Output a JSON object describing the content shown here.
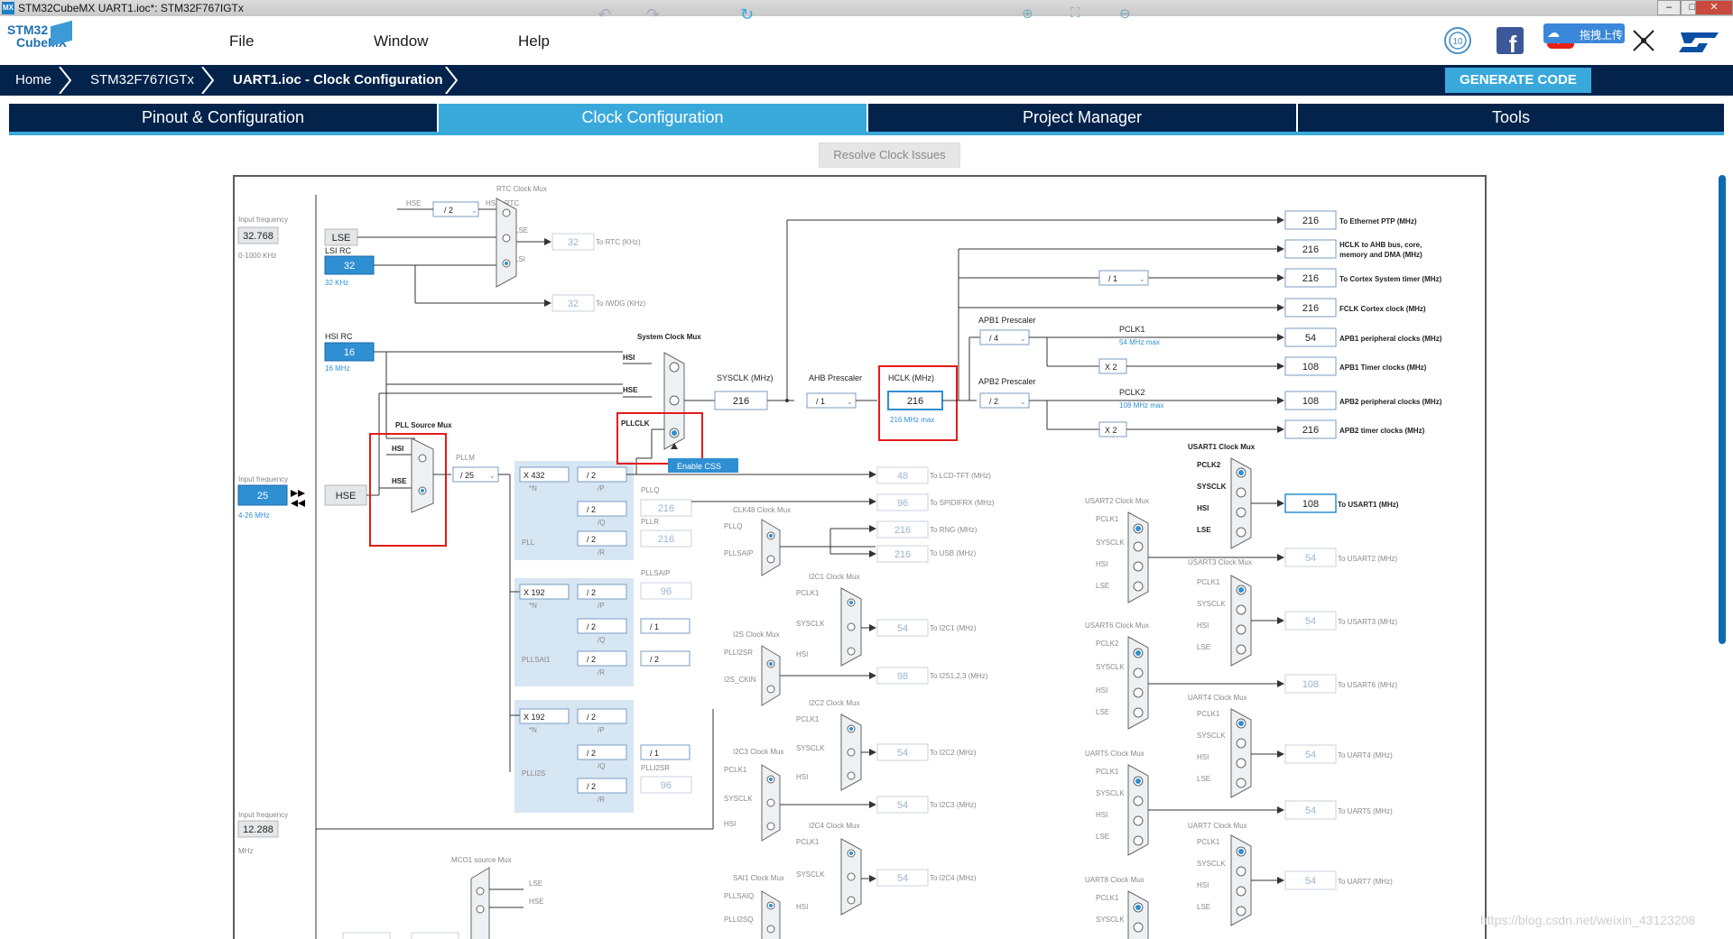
{
  "window": {
    "title": "STM32CubeMX UART1.ioc*: STM32F767IGTx",
    "app_icon": "MX"
  },
  "menubar": {
    "logo_line1": "STM32",
    "logo_line2": "CubeMX",
    "items": [
      "File",
      "Window",
      "Help"
    ],
    "upload_label": "拖拽上传"
  },
  "breadcrumb": [
    "Home",
    "STM32F767IGTx",
    "UART1.ioc - Clock Configuration"
  ],
  "generate_label": "GENERATE CODE",
  "tabs": [
    "Pinout & Configuration",
    "Clock Configuration",
    "Project Manager",
    "Tools"
  ],
  "toolbar": {
    "resolve_label": "Resolve Clock Issues"
  },
  "watermark": "https://blog.csdn.net/weixin_43123208",
  "clock": {
    "lse_input": {
      "label": "Input frequency",
      "value": "32.768",
      "range": "0-1000 KHz",
      "block": "LSE"
    },
    "lsi": {
      "label": "LSI RC",
      "value": "32",
      "unit": "32 KHz"
    },
    "hsi": {
      "label": "HSI RC",
      "value": "16",
      "unit": "16 MHz"
    },
    "hse_input": {
      "label": "Input frequency",
      "value": "25",
      "range": "4-26 MHz",
      "block": "HSE"
    },
    "i2s_input": {
      "label": "Input frequency",
      "value": "12.288",
      "unit": "MHz"
    },
    "rtc_mux": {
      "title": "RTC Clock Mux",
      "hse": "HSE",
      "div": "/ 2",
      "hse_rtc": "HSE_RTC",
      "lse": "LSE",
      "lsi": "LSI",
      "out_value": "32",
      "out_label": "To RTC (KHz)"
    },
    "iwdg": {
      "value": "32",
      "label": "To IWDG (KHz)"
    },
    "pll_source_mux": {
      "title": "PLL Source Mux",
      "hsi": "HSI",
      "hse": "HSE"
    },
    "pllm": {
      "label": "PLLM",
      "value": "/ 25"
    },
    "pll": {
      "label": "PLL",
      "n": "X 432",
      "n_label": "*N",
      "p": "/ 2",
      "p_label": "/P",
      "q": "/ 2",
      "q_label": "/Q",
      "r": "/ 2",
      "r_label": "/R",
      "pllq_label": "PLLQ",
      "pllq_value": "216",
      "pllr_label": "PLLR",
      "pllr_value": "216"
    },
    "pllsai1": {
      "label": "PLLSAI1",
      "n": "X 192",
      "n_label": "*N",
      "p": "/ 2",
      "p_label": "/P",
      "q": "/ 2",
      "q_label": "/Q",
      "r": "/ 2",
      "r_label": "/R",
      "pllsaip_label": "PLLSAIP",
      "pllsaip_value": "96",
      "q_div": "/ 1",
      "r_div": "/ 2"
    },
    "plli2s": {
      "label": "PLLI2S",
      "n": "X 192",
      "n_label": "*N",
      "p": "/ 2",
      "p_label": "/P",
      "q": "/ 2",
      "q_label": "/Q",
      "r": "/ 2",
      "r_label": "/R",
      "q_div": "/ 1",
      "plli2sr_label": "PLLI2SR",
      "plli2sr_value": "96"
    },
    "system_mux": {
      "title": "System Clock Mux",
      "hsi": "HSI",
      "hse": "HSE",
      "pllclk": "PLLCLK",
      "css": "Enable CSS"
    },
    "sysclk": {
      "label": "SYSCLK (MHz)",
      "value": "216"
    },
    "ahb": {
      "label": "AHB Prescaler",
      "value": "/ 1"
    },
    "hclk": {
      "label": "HCLK (MHz)",
      "value": "216",
      "max": "216 MHz max"
    },
    "apb1": {
      "label": "APB1 Prescaler",
      "value": "/ 4",
      "pclk": "PCLK1",
      "max": "54 MHz max"
    },
    "apb2": {
      "label": "APB2 Prescaler",
      "value": "/ 2",
      "pclk": "PCLK2",
      "max": "108 MHz max"
    },
    "cortex_div": "/ 1",
    "x2": "X 2",
    "outputs": [
      {
        "value": "216",
        "label": "To Ethernet PTP (MHz)"
      },
      {
        "value": "216",
        "label": "HCLK to AHB bus, core,",
        "label2": "memory and DMA (MHz)"
      },
      {
        "value": "216",
        "label": "To Cortex System timer (MHz)"
      },
      {
        "value": "216",
        "label": "FCLK Cortex clock (MHz)"
      },
      {
        "value": "54",
        "label": "APB1 peripheral clocks (MHz)"
      },
      {
        "value": "108",
        "label": "APB1 Timer clocks (MHz)"
      },
      {
        "value": "108",
        "label": "APB2 peripheral clocks (MHz)"
      },
      {
        "value": "216",
        "label": "APB2 timer clocks (MHz)"
      }
    ],
    "lcd": {
      "value": "48",
      "label": "To LCD-TFT (MHz)"
    },
    "spdif": {
      "value": "96",
      "label": "To SPIDIFRX (MHz)"
    },
    "clk48_mux": {
      "title": "CLK48 Clock Mux",
      "in1": "PLLQ",
      "in2": "PLLSAIP"
    },
    "rng": {
      "value": "216",
      "label": "To RNG (MHz)"
    },
    "usb": {
      "value": "216",
      "label": "To USB (MHz)"
    },
    "i2s_mux": {
      "title": "I2S Clock Mux",
      "in1": "PLLI2SR",
      "in2": "I2S_CKIN"
    },
    "i2s": {
      "value": "98",
      "label": "To I2S1,2,3 (MHz)"
    },
    "mco1": {
      "title": "MCO1 source Mux",
      "in1": "LSE",
      "in2": "HSE"
    },
    "sai1_mux": {
      "title": "SAI1 Clock Mux",
      "in1": "PLLSAIQ",
      "in2": "PLLI2SQ"
    },
    "i2c_muxes": [
      {
        "title": "I2C1 Clock Mux",
        "in": [
          "PCLK1",
          "SYSCLK",
          "HSI"
        ],
        "value": "54",
        "label": "To I2C1 (MHz)"
      },
      {
        "title": "I2C2 Clock Mux",
        "in": [
          "PCLK1",
          "SYSCLK",
          "HSI"
        ],
        "value": "54",
        "label": "To I2C2 (MHz)"
      },
      {
        "title": "I2C3 Clock Mux",
        "in": [
          "PCLK1",
          "SYSCLK",
          "HSI"
        ],
        "value": "54",
        "label": "To I2C3 (MHz)"
      },
      {
        "title": "I2C4 Clock Mux",
        "in": [
          "PCLK1",
          "SYSCLK",
          "HSI"
        ],
        "value": "54",
        "label": "To I2C4 (MHz)"
      }
    ],
    "usart_left_muxes": [
      {
        "title": "USART2 Clock Mux",
        "in": [
          "PCLK1",
          "SYSCLK",
          "HSI",
          "LSE"
        ]
      },
      {
        "title": "USART6 Clock Mux",
        "in": [
          "PCLK2",
          "SYSCLK",
          "HSI",
          "LSE"
        ]
      },
      {
        "title": "UART5 Clock Mux",
        "in": [
          "PCLK1",
          "SYSCLK",
          "HSI",
          "LSE"
        ]
      },
      {
        "title": "UART8 Clock Mux",
        "in": [
          "PCLK1",
          "SYSCLK"
        ]
      }
    ],
    "usart_right_muxes": [
      {
        "title": "USART1 Clock Mux",
        "in": [
          "PCLK2",
          "SYSCLK",
          "HSI",
          "LSE"
        ],
        "value": "108",
        "label": "To USART1 (MHz)"
      },
      {
        "title": "USART3 Clock Mux",
        "in": [
          "PCLK1",
          "SYSCLK",
          "HSI",
          "LSE"
        ],
        "value": "54",
        "label": "To USART3 (MHz)"
      },
      {
        "title": "UART4 Clock Mux",
        "in": [
          "PCLK1",
          "SYSCLK",
          "HSI",
          "LSE"
        ],
        "value": "54",
        "label": "To UART4 (MHz)"
      },
      {
        "title": "UART7 Clock Mux",
        "in": [
          "PCLK1",
          "SYSCLK",
          "HSI",
          "LSE"
        ],
        "value": "54",
        "label": "To UART7 (MHz)"
      }
    ],
    "usart_outputs": [
      {
        "value": "54",
        "label": "To USART2 (MHz)"
      },
      {
        "value": "108",
        "label": "To USART6 (MHz)"
      },
      {
        "value": "54",
        "label": "To UART5 (MHz)"
      }
    ]
  }
}
